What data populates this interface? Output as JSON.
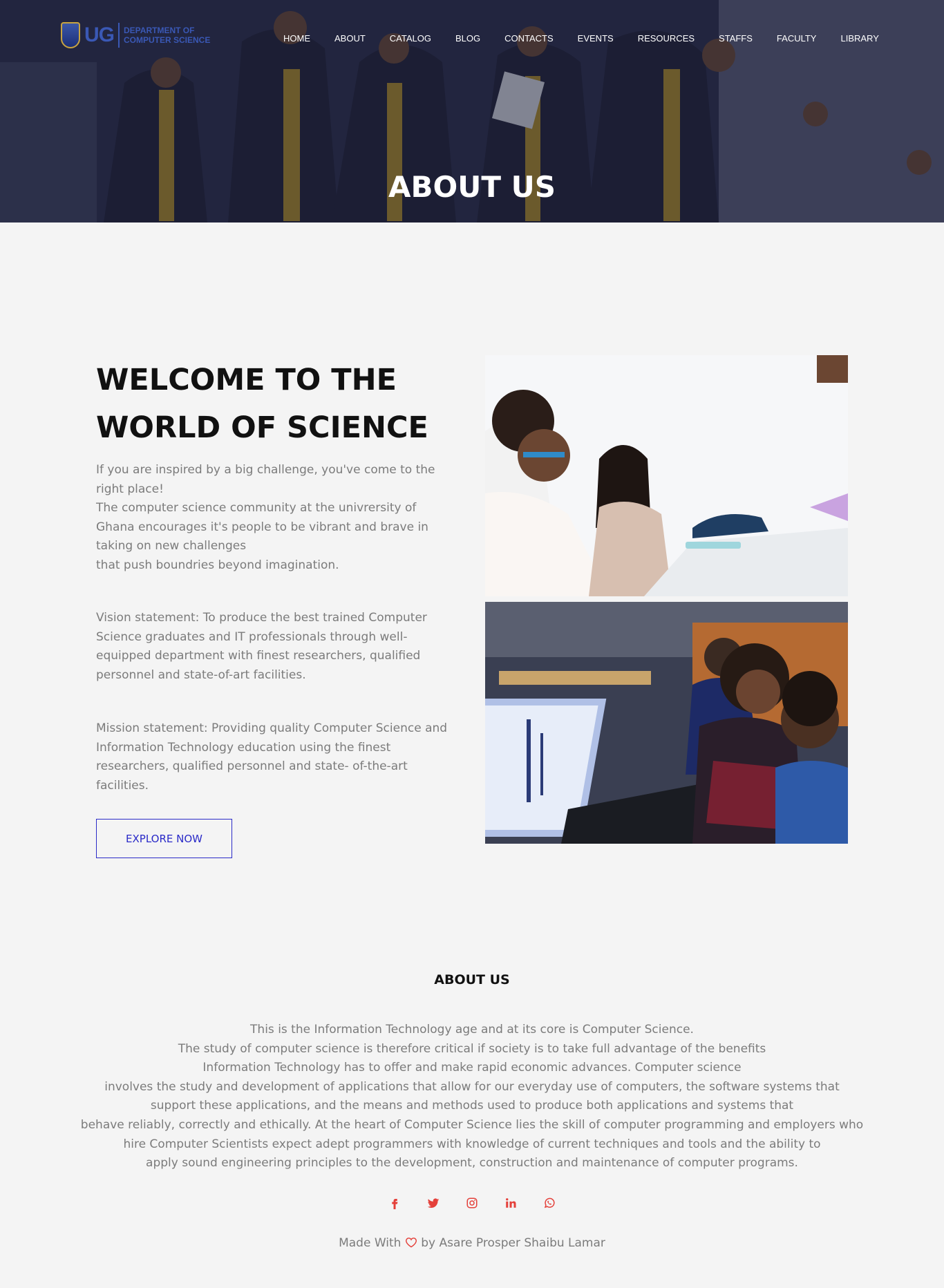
{
  "brand": {
    "logo_mark": "UG",
    "logo_text": "Department of Computer Science"
  },
  "nav": {
    "items": [
      "HOME",
      "ABOUT",
      "CATALOG",
      "BLOG",
      "CONTACTS",
      "EVENTS",
      "RESOURCES",
      "STAFFS",
      "FACULTY",
      "LIBRARY"
    ]
  },
  "hero": {
    "title": "ABOUT US"
  },
  "welcome": {
    "heading_line1": "WELCOME TO THE",
    "heading_line2": "WORLD OF SCIENCE",
    "intro": "If you are inspired by a big challenge, you've come to the right place!\nThe computer science community at the univrersity of Ghana encourages it's people to be vibrant and brave in taking on new challenges\nthat push boundries beyond imagination.",
    "vision": "Vision statement: To produce the best trained Computer Science graduates and IT professionals through well-equipped department with finest researchers, qualified personnel and state-of-art facilities.",
    "mission": "Mission statement: Providing quality Computer Science and Information Technology education using the finest researchers, qualified personnel and state- of-the-art facilities.",
    "button_label": "EXPLORE NOW"
  },
  "about": {
    "heading": "ABOUT US",
    "lines": [
      "This is the Information Technology age and at its core is Computer Science.",
      "The study of computer science is therefore critical if society is to take full advantage of the benefits",
      "Information Technology has to offer and make rapid economic advances. Computer science",
      "involves the study and development of applications that allow for our everyday use of computers, the software systems that",
      "support these applications, and the means and methods used to produce both applications and systems that",
      "behave reliably, correctly and ethically. At the heart of Computer Science lies the skill of computer programming and employers who",
      "hire Computer Scientists expect adept programmers with knowledge of current techniques and tools and the ability to",
      "apply sound engineering principles to the development, construction and maintenance of computer programs."
    ]
  },
  "socials": [
    "facebook-icon",
    "twitter-icon",
    "instagram-icon",
    "linkedin-icon",
    "whatsapp-icon"
  ],
  "footer": {
    "made_with": "Made With",
    "by": "by Asare Prosper Shaibu Lamar"
  },
  "colors": {
    "accent_blue": "#2a2ac8",
    "social_red": "#e4403a",
    "background": "#f4f4f4"
  }
}
